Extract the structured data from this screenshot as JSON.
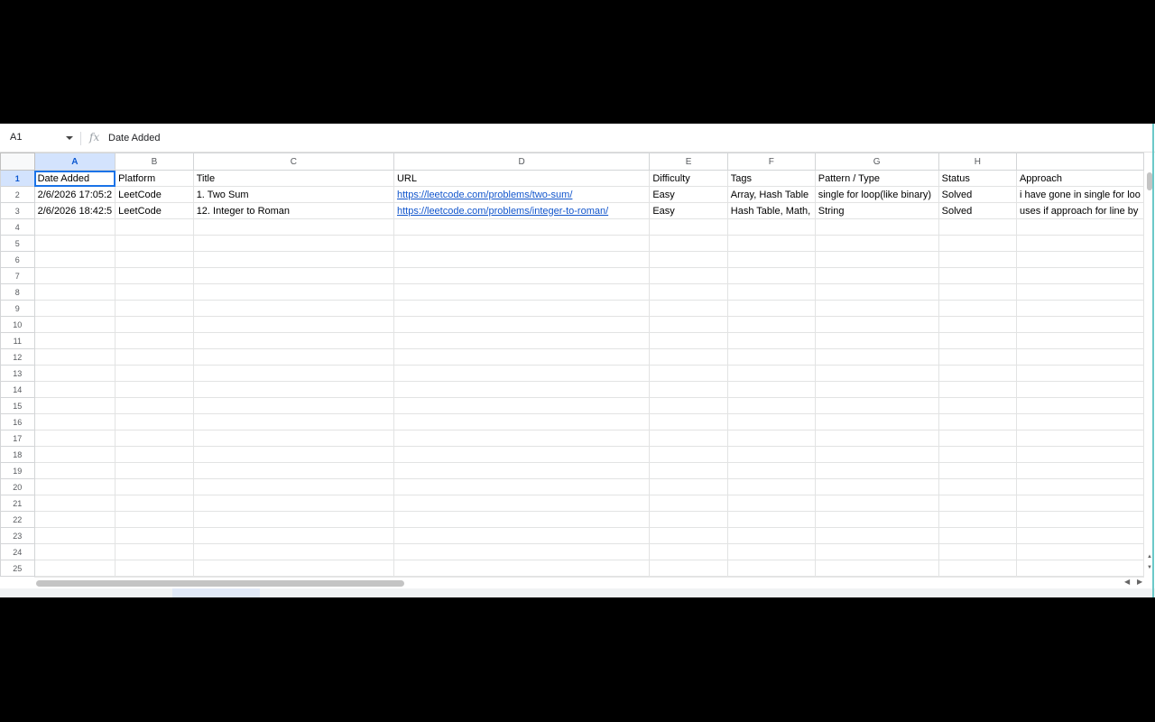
{
  "name_box": "A1",
  "formula": "Date Added",
  "columns": [
    "A",
    "B",
    "C",
    "D",
    "E",
    "F",
    "G",
    "H",
    ""
  ],
  "rows": [
    [
      "Date Added",
      "Platform",
      "Title",
      "URL",
      "Difficulty",
      "Tags",
      "Pattern / Type",
      "Status",
      "Approach"
    ],
    [
      "2/6/2026 17:05:2",
      "LeetCode",
      "1. Two Sum",
      "https://leetcode.com/problems/two-sum/",
      "Easy",
      "Array, Hash Table",
      "single for loop(like binary)",
      "Solved",
      "i have gone in single for loo"
    ],
    [
      "2/6/2026 18:42:5",
      "LeetCode",
      "12. Integer to Roman",
      "https://leetcode.com/problems/integer-to-roman/",
      "Easy",
      "Hash Table, Math, ",
      "String",
      "Solved",
      "uses if approach for line by"
    ]
  ],
  "row_count": 25,
  "link_column": 3,
  "colors": {
    "selection": "#1a73e8",
    "header_selected": "#d3e3fd",
    "link": "#1155cc"
  }
}
